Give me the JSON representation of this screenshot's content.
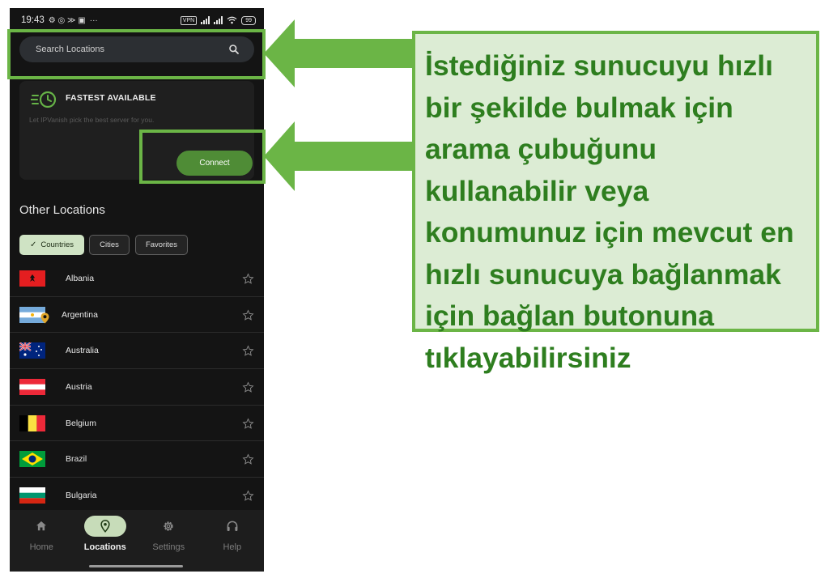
{
  "status_bar": {
    "time": "19:43",
    "dots": "···",
    "vpn": "VPN",
    "battery": "99"
  },
  "search": {
    "placeholder": "Search Locations"
  },
  "fastest": {
    "title": "FASTEST AVAILABLE",
    "subtitle": "Let IPVanish pick the best server for you.",
    "connect_label": "Connect"
  },
  "other_locations": {
    "title": "Other Locations",
    "filters": [
      {
        "label": "Countries",
        "active": true
      },
      {
        "label": "Cities",
        "active": false
      },
      {
        "label": "Favorites",
        "active": false
      }
    ],
    "countries": [
      {
        "name": "Albania"
      },
      {
        "name": "Argentina"
      },
      {
        "name": "Australia"
      },
      {
        "name": "Austria"
      },
      {
        "name": "Belgium"
      },
      {
        "name": "Brazil"
      },
      {
        "name": "Bulgaria"
      }
    ]
  },
  "nav": [
    {
      "label": "Home",
      "icon": "home-icon",
      "active": false
    },
    {
      "label": "Locations",
      "icon": "location-pin-icon",
      "active": true
    },
    {
      "label": "Settings",
      "icon": "gear-icon",
      "active": false
    },
    {
      "label": "Help",
      "icon": "headphones-icon",
      "active": false
    }
  ],
  "annotation": {
    "text": "İstediğiniz sunucuyu hızlı bir şekilde bulmak için arama çubuğunu kullanabilir veya konumunuz için mevcut en hızlı sunucuya bağlanmak için bağlan butonuna tıklayabilirsiniz",
    "color": "#6bb546",
    "text_color": "#2e7e1f",
    "background": "#dcecd4"
  },
  "colors": {
    "accent": "#4f8c36",
    "active_chip": "#cfe3c4",
    "background": "#141414"
  }
}
